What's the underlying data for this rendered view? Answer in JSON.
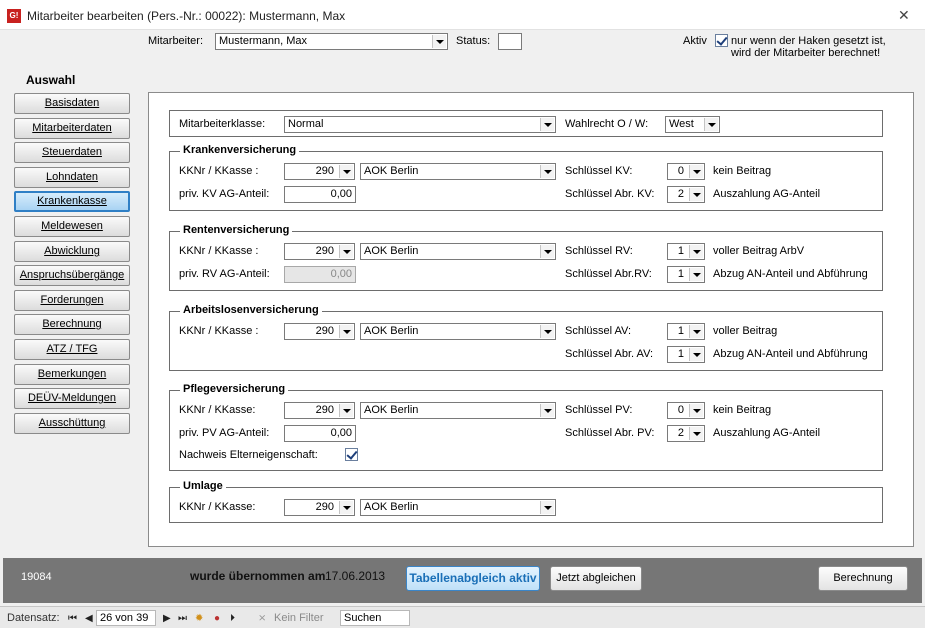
{
  "window": {
    "title": "Mitarbeiter bearbeiten (Pers.-Nr.: 00022): Mustermann, Max",
    "app_icon": "G!"
  },
  "header": {
    "mitarbeiter_label": "Mitarbeiter:",
    "mitarbeiter_value": "Mustermann, Max",
    "status_label": "Status:",
    "status_value": "",
    "aktiv_label": "Aktiv",
    "aktiv_checked": true,
    "aktiv_hint_1": "nur wenn der Haken gesetzt ist,",
    "aktiv_hint_2": "wird der Mitarbeiter berechnet!"
  },
  "sidebar": {
    "title": "Auswahl",
    "items": [
      {
        "label": "Basisdaten"
      },
      {
        "label": "Mitarbeiterdaten"
      },
      {
        "label": "Steuerdaten"
      },
      {
        "label": "Lohndaten"
      },
      {
        "label": "Krankenkasse",
        "active": true
      },
      {
        "label": "Meldewesen"
      },
      {
        "label": "Abwicklung"
      },
      {
        "label": "Anspruchsübergänge"
      },
      {
        "label": "Forderungen"
      },
      {
        "label": "Berechnung"
      },
      {
        "label": "ATZ / TFG"
      },
      {
        "label": "Bemerkungen"
      },
      {
        "label": "DEÜV-Meldungen"
      },
      {
        "label": "Ausschüttung"
      }
    ]
  },
  "main": {
    "klasse": {
      "label": "Mitarbeiterklasse:",
      "value": "Normal",
      "wahlrecht_label": "Wahlrecht O / W:",
      "wahlrecht_value": "West"
    },
    "kv": {
      "title": "Krankenversicherung",
      "kk_label": "KKNr / KKasse :",
      "kk_nr": "290",
      "kk_name": "AOK Berlin",
      "ag_label": "priv. KV AG-Anteil:",
      "ag_value": "0,00",
      "key1_label": "Schlüssel KV:",
      "key1_value": "0",
      "key1_text": "kein Beitrag",
      "key2_label": "Schlüssel Abr. KV:",
      "key2_value": "2",
      "key2_text": "Auszahlung AG-Anteil"
    },
    "rv": {
      "title": "Rentenversicherung",
      "kk_label": "KKNr / KKasse :",
      "kk_nr": "290",
      "kk_name": "AOK Berlin",
      "ag_label": "priv. RV AG-Anteil:",
      "ag_value": "0,00",
      "key1_label": "Schlüssel RV:",
      "key1_value": "1",
      "key1_text": "voller Beitrag ArbV",
      "key2_label": "Schlüssel Abr.RV:",
      "key2_value": "1",
      "key2_text": "Abzug AN-Anteil und Abführung"
    },
    "av": {
      "title": "Arbeitslosenversicherung",
      "kk_label": "KKNr / KKasse :",
      "kk_nr": "290",
      "kk_name": "AOK Berlin",
      "key1_label": "Schlüssel AV:",
      "key1_value": "1",
      "key1_text": "voller Beitrag",
      "key2_label": "Schlüssel Abr. AV:",
      "key2_value": "1",
      "key2_text": "Abzug AN-Anteil und Abführung"
    },
    "pv": {
      "title": "Pflegeversicherung",
      "kk_label": "KKNr / KKasse:",
      "kk_nr": "290",
      "kk_name": "AOK Berlin",
      "ag_label": "priv. PV AG-Anteil:",
      "ag_value": "0,00",
      "key1_label": "Schlüssel PV:",
      "key1_value": "0",
      "key1_text": "kein Beitrag",
      "key2_label": "Schlüssel Abr. PV:",
      "key2_value": "2",
      "key2_text": "Auszahlung AG-Anteil",
      "eltern_label": "Nachweis Elterneigenschaft:",
      "eltern_checked": true
    },
    "umlage": {
      "title": "Umlage",
      "kk_label": "KKNr / KKasse:",
      "kk_nr": "290",
      "kk_name": "AOK Berlin"
    }
  },
  "footer": {
    "id": "19084",
    "uebernommen_text": "wurde übernommen am",
    "date": "17.06.2013",
    "tabellenabgleich_button": "Tabellenabgleich aktiv",
    "jetzt_button": "Jetzt abgleichen",
    "berechnung_button": "Berechnung"
  },
  "statusbar": {
    "datensatz_label": "Datensatz:",
    "record": "26 von 39",
    "filter_label": "Kein Filter",
    "search_placeholder": "Suchen"
  }
}
